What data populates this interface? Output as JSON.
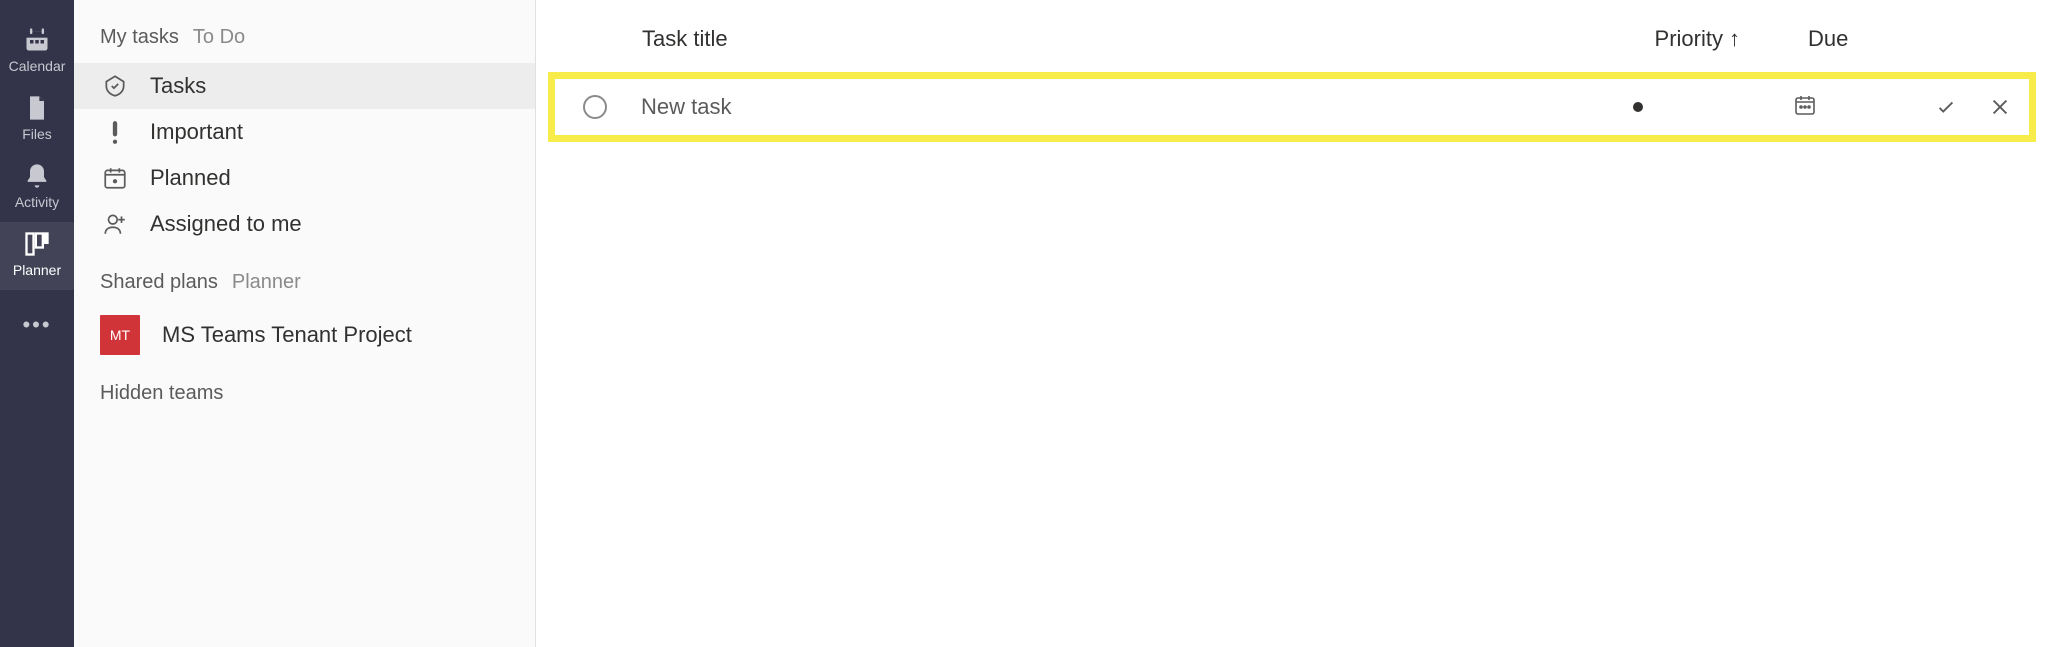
{
  "rail": {
    "items": [
      {
        "label": "Calendar",
        "icon": "calendar"
      },
      {
        "label": "Files",
        "icon": "file"
      },
      {
        "label": "Activity",
        "icon": "bell"
      },
      {
        "label": "Planner",
        "icon": "planner"
      }
    ]
  },
  "nav": {
    "sections": [
      {
        "title": "My tasks",
        "sub": "To Do"
      },
      {
        "title": "Shared plans",
        "sub": "Planner"
      }
    ],
    "mytasks": [
      {
        "label": "Tasks"
      },
      {
        "label": "Important"
      },
      {
        "label": "Planned"
      },
      {
        "label": "Assigned to me"
      }
    ],
    "plans": [
      {
        "initials": "MT",
        "label": "MS Teams Tenant Project"
      }
    ],
    "hidden": "Hidden teams"
  },
  "columns": {
    "title": "Task title",
    "priority": "Priority",
    "due": "Due",
    "sort_arrow": "↑"
  },
  "newtask": {
    "placeholder": "New task"
  }
}
